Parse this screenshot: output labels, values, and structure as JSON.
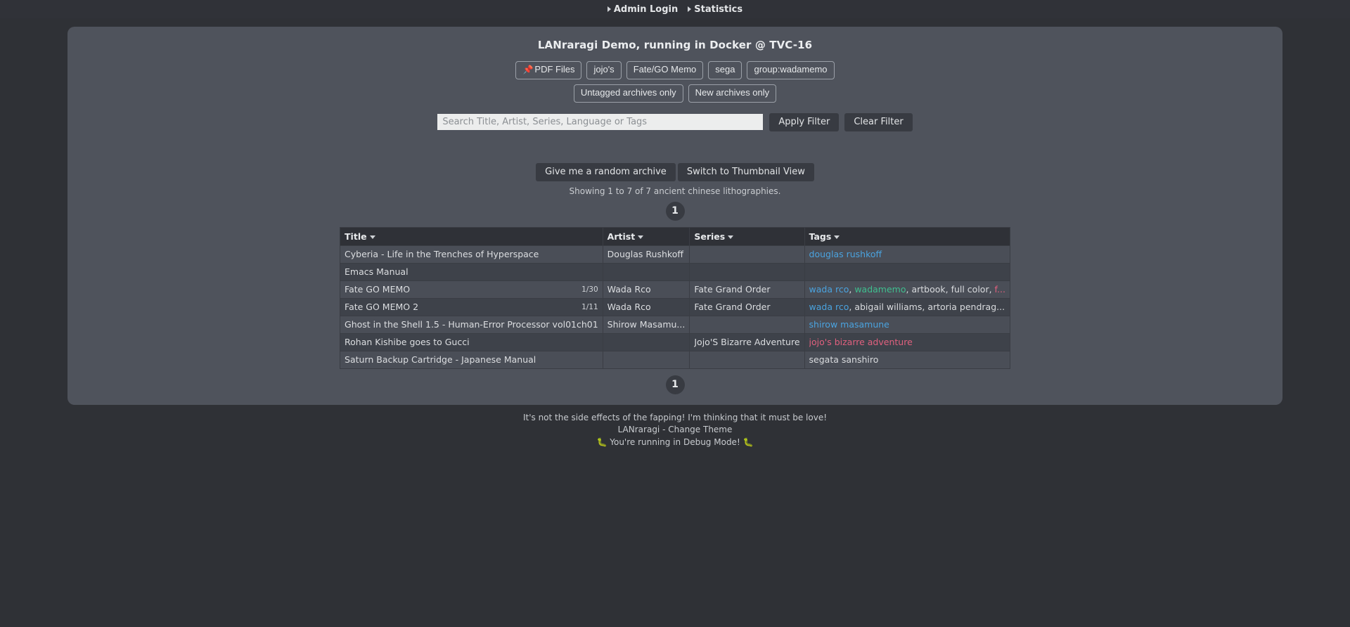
{
  "topnav": {
    "items": [
      {
        "label": "Admin Login",
        "icon": "caret-right-icon"
      },
      {
        "label": "Statistics",
        "icon": "caret-right-icon"
      }
    ]
  },
  "panel": {
    "title": "LANraragi Demo, running in Docker @ TVC-16",
    "filter_pills_row1": [
      {
        "label": "PDF Files",
        "emoji": "📌",
        "pinned": true
      },
      {
        "label": "jojo's",
        "pinned": false
      },
      {
        "label": "Fate/GO Memo",
        "pinned": false
      },
      {
        "label": "sega",
        "pinned": false
      },
      {
        "label": "group:wadamemo",
        "pinned": false
      }
    ],
    "filter_pills_row2": [
      {
        "label": "Untagged archives only"
      },
      {
        "label": "New archives only"
      }
    ],
    "search": {
      "placeholder": "Search Title, Artist, Series, Language or Tags",
      "value": "",
      "apply_label": "Apply Filter",
      "clear_label": "Clear Filter"
    },
    "actions": {
      "random_label": "Give me a random archive",
      "view_toggle_label": "Switch to Thumbnail View"
    },
    "showing_text": "Showing 1 to 7 of 7 ancient chinese lithographies.",
    "pagination": {
      "current": "1"
    },
    "table": {
      "columns": [
        {
          "label": "Title",
          "sort_icon": "sort-caret-icon"
        },
        {
          "label": "Artist",
          "sort_icon": "sort-caret-icon"
        },
        {
          "label": "Series",
          "sort_icon": "sort-caret-icon"
        },
        {
          "label": "Tags",
          "sort_icon": "sort-caret-icon"
        }
      ],
      "rows": [
        {
          "title": "Cyberia - Life in the Trenches of Hyperspace",
          "pagecount": "",
          "artist": "Douglas Rushkoff",
          "series": "",
          "tags_html": "<span class=\"tag-artist\">douglas rushkoff</span>"
        },
        {
          "title": "Emacs Manual",
          "pagecount": "",
          "artist": "",
          "series": "",
          "tags_html": ""
        },
        {
          "title": "Fate GO MEMO",
          "pagecount": "1/30",
          "artist": "Wada Rco",
          "series": "Fate Grand Order",
          "tags_html": "<span class=\"tag-artist\">wada rco</span><span class=\"tag-other\">, </span><span class=\"tag-group\">wadamemo</span><span class=\"tag-other\">, artbook, full color, </span><span class=\"tag-pink\">f...</span>"
        },
        {
          "title": "Fate GO MEMO 2",
          "pagecount": "1/11",
          "artist": "Wada Rco",
          "series": "Fate Grand Order",
          "tags_html": "<span class=\"tag-artist\">wada rco</span><span class=\"tag-other\">, abigail williams, artoria pendrag...</span>"
        },
        {
          "title": "Ghost in the Shell 1.5 - Human-Error Processor vol01ch01",
          "pagecount": "",
          "artist": "Shirow Masamu...",
          "series": "",
          "tags_html": "<span class=\"tag-artist\">shirow masamune</span>"
        },
        {
          "title": "Rohan Kishibe goes to Gucci",
          "pagecount": "",
          "artist": "",
          "series": "Jojo'S Bizarre Adventure",
          "tags_html": "<span class=\"tag-pink\">jojo's bizarre adventure</span>"
        },
        {
          "title": "Saturn Backup Cartridge - Japanese Manual",
          "pagecount": "",
          "artist": "",
          "series": "",
          "tags_html": "<span class=\"tag-other\">segata sanshiro</span>"
        }
      ]
    }
  },
  "footer": {
    "tagline": "It's not the side effects of the fapping! I'm thinking that it must be love!",
    "app_name": "LANraragi",
    "separator": " - ",
    "theme_link": "Change Theme",
    "debug_text": "🐛 You're running in Debug Mode! 🐛"
  },
  "colors": {
    "page_bg": "#2f3136",
    "panel_bg": "#4f535c",
    "dark_btn": "#383b42",
    "tag_artist": "#4aa3df",
    "tag_group": "#3fbf8f",
    "tag_pink": "#e0607e",
    "row_odd": "#4a4e57",
    "row_even": "#3e424a"
  }
}
